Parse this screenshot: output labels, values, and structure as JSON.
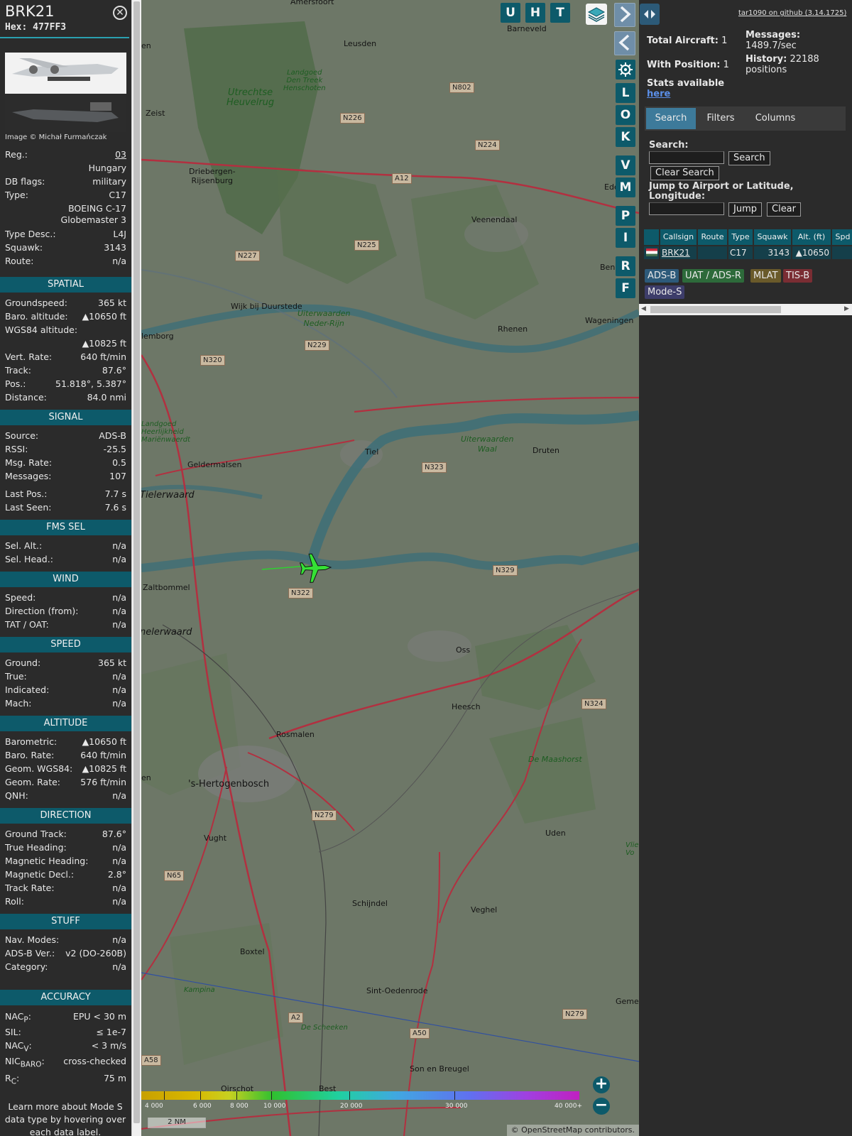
{
  "detail": {
    "callsign": "BRK21",
    "hex_label": "Hex:",
    "hex": "477FF3",
    "close_icon": "close-icon",
    "image_credit": "Image © Michał Furmańczak",
    "fields": {
      "reg_k": "Reg.:",
      "reg_v": "03",
      "country": "Hungary",
      "dbflags_k": "DB flags:",
      "dbflags_v": "military",
      "type_k": "Type:",
      "type_v": "C17",
      "type_name_1": "BOEING C-17",
      "type_name_2": "Globemaster 3",
      "typedesc_k": "Type Desc.:",
      "typedesc_v": "L4J",
      "squawk_k": "Squawk:",
      "squawk_v": "3143",
      "route_k": "Route:",
      "route_v": "n/a"
    },
    "spatial": {
      "title": "SPATIAL",
      "gs_k": "Groundspeed:",
      "gs_v": "365 kt",
      "baro_k": "Baro. altitude:",
      "baro_v": "▲10650 ft",
      "wgs_k": "WGS84 altitude:",
      "wgs_v": "▲10825 ft",
      "vr_k": "Vert. Rate:",
      "vr_v": "640 ft/min",
      "track_k": "Track:",
      "track_v": "87.6°",
      "pos_k": "Pos.:",
      "pos_v": "51.818°, 5.387°",
      "dist_k": "Distance:",
      "dist_v": "84.0 nmi"
    },
    "signal": {
      "title": "SIGNAL",
      "source_k": "Source:",
      "source_v": "ADS-B",
      "rssi_k": "RSSI:",
      "rssi_v": "-25.5",
      "msgrate_k": "Msg. Rate:",
      "msgrate_v": "0.5",
      "messages_k": "Messages:",
      "messages_v": "107",
      "lastpos_k": "Last Pos.:",
      "lastpos_v": "7.7 s",
      "lastseen_k": "Last Seen:",
      "lastseen_v": "7.6 s"
    },
    "fms": {
      "title": "FMS SEL",
      "selalt_k": "Sel. Alt.:",
      "selalt_v": "n/a",
      "selhead_k": "Sel. Head.:",
      "selhead_v": "n/a"
    },
    "wind": {
      "title": "WIND",
      "speed_k": "Speed:",
      "speed_v": "n/a",
      "dir_k": "Direction (from):",
      "dir_v": "n/a",
      "tat_k": "TAT / OAT:",
      "tat_v": "n/a"
    },
    "speed": {
      "title": "SPEED",
      "ground_k": "Ground:",
      "ground_v": "365 kt",
      "true_k": "True:",
      "true_v": "n/a",
      "ind_k": "Indicated:",
      "ind_v": "n/a",
      "mach_k": "Mach:",
      "mach_v": "n/a"
    },
    "altitude": {
      "title": "ALTITUDE",
      "baro_k": "Barometric:",
      "baro_v": "▲10650 ft",
      "barorate_k": "Baro. Rate:",
      "barorate_v": "640 ft/min",
      "geom_k": "Geom. WGS84:",
      "geom_v": "▲10825 ft",
      "geomrate_k": "Geom. Rate:",
      "geomrate_v": "576 ft/min",
      "qnh_k": "QNH:",
      "qnh_v": "n/a"
    },
    "direction": {
      "title": "DIRECTION",
      "gt_k": "Ground Track:",
      "gt_v": "87.6°",
      "th_k": "True Heading:",
      "th_v": "n/a",
      "mh_k": "Magnetic Heading:",
      "mh_v": "n/a",
      "md_k": "Magnetic Decl.:",
      "md_v": "2.8°",
      "tr_k": "Track Rate:",
      "tr_v": "n/a",
      "roll_k": "Roll:",
      "roll_v": "n/a"
    },
    "stuff": {
      "title": "STUFF",
      "nav_k": "Nav. Modes:",
      "nav_v": "n/a",
      "adsb_k": "ADS-B Ver.:",
      "adsb_v": "v2 (DO-260B)",
      "cat_k": "Category:",
      "cat_v": "n/a"
    },
    "accuracy": {
      "title": "ACCURACY",
      "nacp_k": "NAC",
      "nacp_sub": "P",
      "nacp_v": "EPU < 30 m",
      "sil_k": "SIL:",
      "sil_v": "≤ 1e-7",
      "nacv_k": "NAC",
      "nacv_sub": "V",
      "nacv_v": "< 3 m/s",
      "nic_k": "NIC",
      "nic_sub": "BARO",
      "nic_v": "cross-checked",
      "rc_k": "R",
      "rc_sub": "C",
      "rc_v": "75 m"
    },
    "learn_more": "Learn more about Mode S data type by hovering over each data label."
  },
  "map": {
    "buttons": {
      "u": "U",
      "h": "H",
      "t": "T",
      "l": "L",
      "o": "O",
      "k": "K",
      "v": "V",
      "m": "M",
      "p": "P",
      "i": "I",
      "r": "R",
      "f": "F"
    },
    "next_icon": "chevron-right-icon",
    "prev_icon": "chevron-left-icon",
    "settings_icon": "gear-icon",
    "layers_icon": "layers-icon",
    "places": {
      "amersfoort": "Amersfoort",
      "barneveld": "Barneveld",
      "leusden": "Leusden",
      "zeist": "Zeist",
      "driebergen": "Driebergen-\nRijsenburg",
      "veenendaal": "Veenendaal",
      "ede": "Ede",
      "wijk": "Wijk bij Duurstede",
      "rhenen": "Rhenen",
      "wageningen": "Wageningen",
      "culemborg": "lemborg",
      "geldermalsen": "Geldermalsen",
      "tiel": "Tiel",
      "druten": "Druten",
      "tielerwaard": "Tielerwaard",
      "zaltbommel": "Zaltbommel",
      "bommelerwaard": "nelerwaard",
      "oss": "Oss",
      "heesch": "Heesch",
      "rosmalen": "Rosmalen",
      "hertogenbosch": "'s-Hertogenbosch",
      "vught": "Vught",
      "uden": "Uden",
      "schijndel": "Schijndel",
      "veghel": "Veghel",
      "boxtel": "Boxtel",
      "sintoedenrode": "Sint-Oedenrode",
      "sonenbreugel": "Son en Breugel",
      "gemert": "Gemer",
      "benn": "Benn",
      "en1": "en",
      "en2": "en",
      "oirschot": "Oirschot",
      "best": "Best"
    },
    "green_labels": {
      "heuvelrug": "Utrechtse\nHeuvelrug",
      "landgoed": "Landgoed\nDen Treek\nHenschoten",
      "neder_rijn": "Uiterwaarden\nNeder-Rijn",
      "waal": "Uiterwaarden\nWaal",
      "maashorst": "De Maashorst",
      "kampina": "Kampina",
      "scheeken": "De Scheeken",
      "vlie": "Vlie\nVo",
      "lingewaard": "Landgoed\nHeerlijkheid\nMariënwaerdt"
    },
    "roads": {
      "n802": "N802",
      "n226": "N226",
      "n224": "N224",
      "a12": "A12",
      "n227": "N227",
      "n225": "N225",
      "n229": "N229",
      "n320": "N320",
      "n323": "N323",
      "n322": "N322",
      "n329": "N329",
      "n324": "N324",
      "n279a": "N279",
      "n65": "N65",
      "a2": "A2",
      "a50": "A50",
      "a58": "A58",
      "n279b": "N279"
    },
    "altitude_scale": {
      "labels": [
        "4 000",
        "6 000",
        "8 000",
        "10 000",
        "20 000",
        "30 000",
        "40 000+"
      ]
    },
    "scale_bar": "2 NM",
    "zoom_in": "+",
    "zoom_out": "−",
    "attribution": "© OpenStreetMap contributors."
  },
  "info": {
    "github_link": "tar1090 on github (3.14.1725)",
    "total_aircraft_label": "Total Aircraft:",
    "total_aircraft": "1",
    "with_position_label": "With Position:",
    "with_position": "1",
    "messages_label": "Messages:",
    "messages_rate": "1489.7/sec",
    "history_label": "History:",
    "history_value": "22188",
    "history_unit": "positions",
    "stats_text": "Stats available",
    "stats_link": "here",
    "tabs": [
      "Search",
      "Filters",
      "Columns"
    ],
    "search_label": "Search:",
    "search_button": "Search",
    "clear_search_button": "Clear Search",
    "jump_label": "Jump to Airport or Latitude, Longitude:",
    "jump_button": "Jump",
    "clear_button": "Clear",
    "table": {
      "headers": [
        "Callsign",
        "Route",
        "Type",
        "Squawk",
        "Alt. (ft)",
        "Spd"
      ],
      "row": {
        "callsign": "BRK21",
        "route": "",
        "type": "C17",
        "squawk": "3143",
        "alt": "▲10650",
        "spd": ""
      }
    },
    "sources": [
      "ADS-B",
      "UAT / ADS-R",
      "MLAT",
      "TIS-B",
      "Mode-S"
    ],
    "colors": {
      "adsb": "#2d5a7a",
      "uat": "#2d6a3a",
      "mlat": "#6a5a2a",
      "tisb": "#7a2d33",
      "modes": "#3d3d6a"
    }
  }
}
